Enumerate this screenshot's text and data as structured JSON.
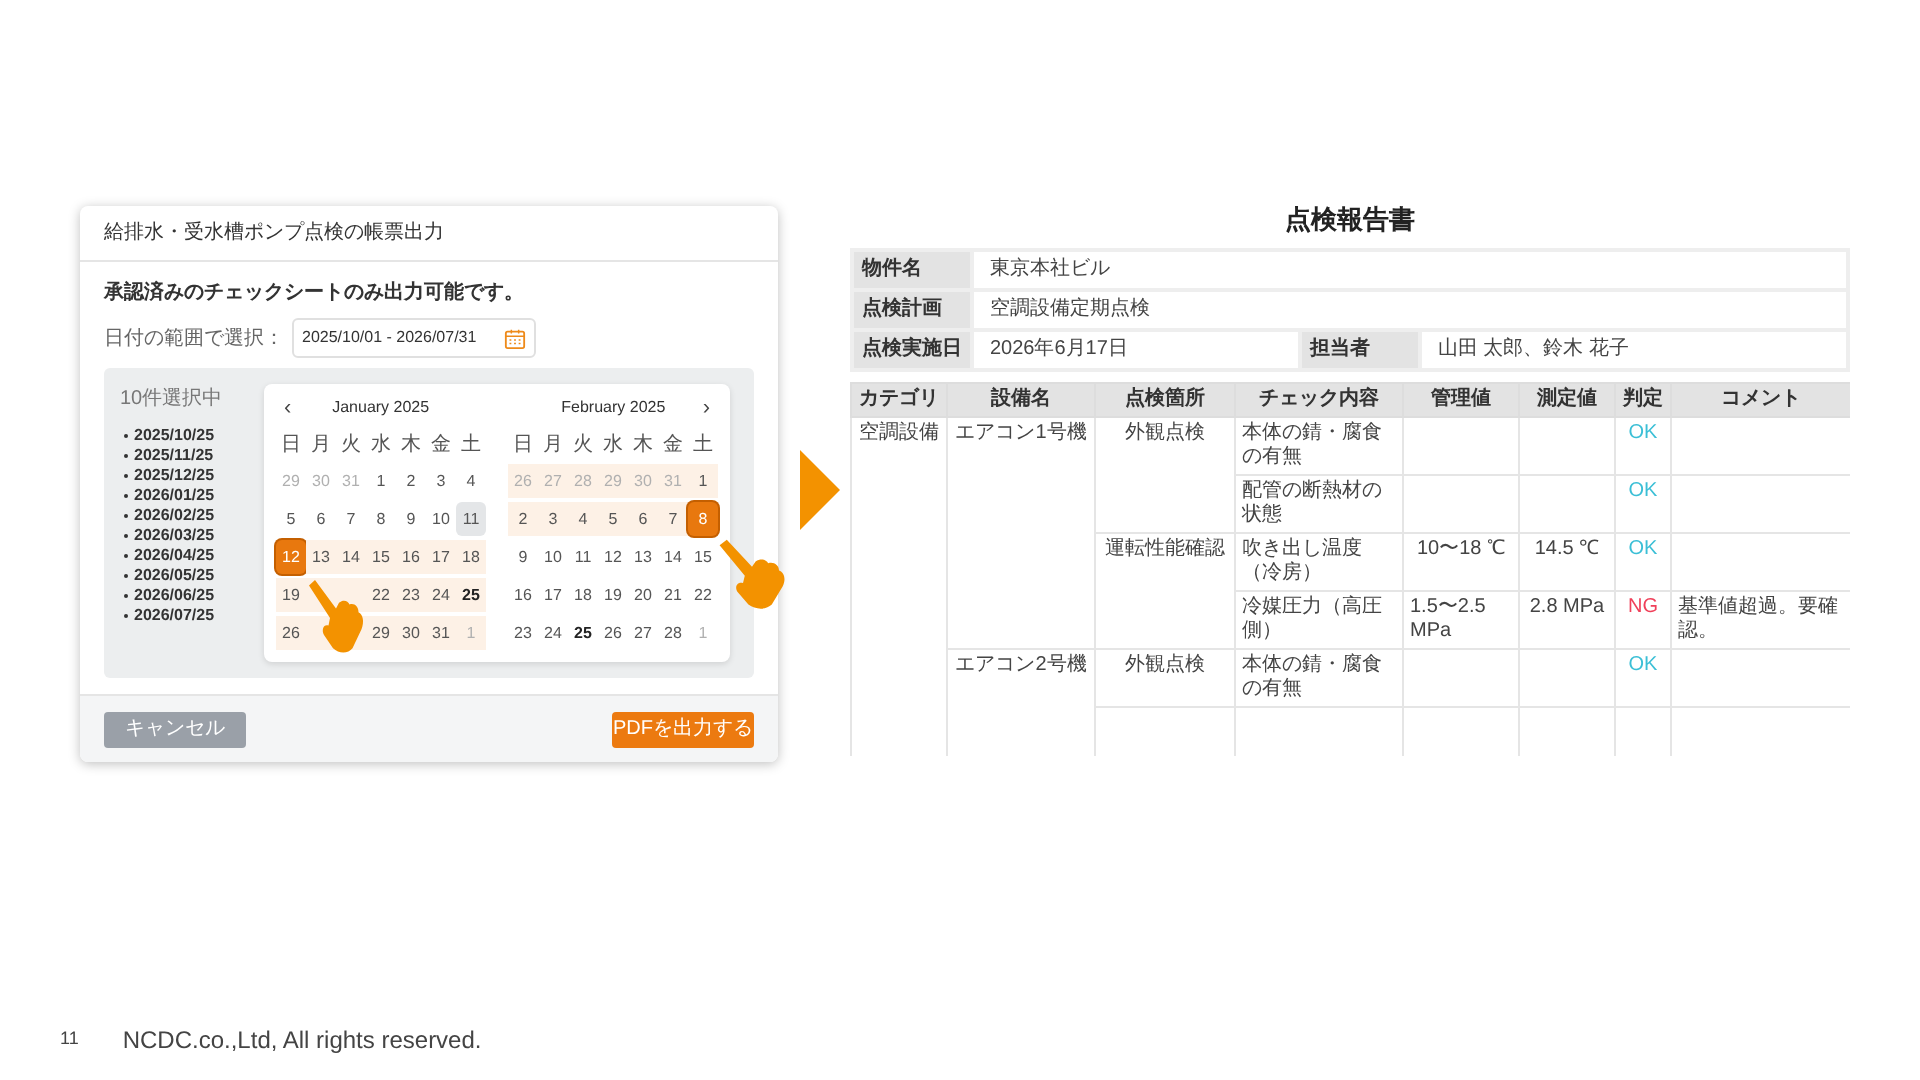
{
  "dialog": {
    "title": "給排水・受水槽ポンプ点検の帳票出力",
    "notice": "承認済みのチェックシートのみ出力可能です。",
    "date_label": "日付の範囲で選択：",
    "date_value": "2025/10/01 - 2026/07/31",
    "selected_count": "10件選択中",
    "selected_dates": [
      "2025/10/25",
      "2025/11/25",
      "2025/12/25",
      "2026/01/25",
      "2026/02/25",
      "2026/03/25",
      "2026/04/25",
      "2026/05/25",
      "2026/06/25",
      "2026/07/25"
    ],
    "prev": "‹",
    "next": "›",
    "months": [
      {
        "title": "January 2025",
        "weekdays": [
          "日",
          "月",
          "火",
          "水",
          "木",
          "金",
          "土"
        ],
        "weeks": [
          [
            {
              "day": "29",
              "kind": "muted"
            },
            {
              "day": "30",
              "kind": "muted"
            },
            {
              "day": "31",
              "kind": "muted"
            },
            {
              "day": "1",
              "kind": "plain"
            },
            {
              "day": "2",
              "kind": "plain"
            },
            {
              "day": "3",
              "kind": "plain"
            },
            {
              "day": "4",
              "kind": "plain"
            }
          ],
          [
            {
              "day": "5",
              "kind": "plain"
            },
            {
              "day": "6",
              "kind": "plain"
            },
            {
              "day": "7",
              "kind": "plain"
            },
            {
              "day": "8",
              "kind": "plain"
            },
            {
              "day": "9",
              "kind": "plain"
            },
            {
              "day": "10",
              "kind": "plain"
            },
            {
              "day": "11",
              "kind": "today"
            }
          ],
          [
            {
              "day": "12",
              "kind": "endpoint"
            },
            {
              "day": "13",
              "kind": "range"
            },
            {
              "day": "14",
              "kind": "range"
            },
            {
              "day": "15",
              "kind": "range"
            },
            {
              "day": "16",
              "kind": "range"
            },
            {
              "day": "17",
              "kind": "range"
            },
            {
              "day": "18",
              "kind": "range"
            }
          ],
          [
            {
              "day": "19",
              "kind": "range"
            },
            {
              "kind": "range"
            },
            {
              "kind": "range"
            },
            {
              "day": "22",
              "kind": "range"
            },
            {
              "day": "23",
              "kind": "range"
            },
            {
              "day": "24",
              "kind": "range"
            },
            {
              "day": "25",
              "kind": "range_bold"
            }
          ],
          [
            {
              "day": "26",
              "kind": "range"
            },
            {
              "kind": "range"
            },
            {
              "kind": "range"
            },
            {
              "day": "29",
              "kind": "range"
            },
            {
              "day": "30",
              "kind": "range"
            },
            {
              "day": "31",
              "kind": "range"
            },
            {
              "day": "1",
              "kind": "range_muted"
            }
          ]
        ]
      },
      {
        "title": "February 2025",
        "weekdays": [
          "日",
          "月",
          "火",
          "水",
          "木",
          "金",
          "土"
        ],
        "weeks": [
          [
            {
              "day": "26",
              "kind": "range_muted"
            },
            {
              "day": "27",
              "kind": "range_muted"
            },
            {
              "day": "28",
              "kind": "range_muted"
            },
            {
              "day": "29",
              "kind": "range_muted"
            },
            {
              "day": "30",
              "kind": "range_muted"
            },
            {
              "day": "31",
              "kind": "range_muted"
            },
            {
              "day": "1",
              "kind": "range"
            }
          ],
          [
            {
              "day": "2",
              "kind": "range"
            },
            {
              "day": "3",
              "kind": "range"
            },
            {
              "day": "4",
              "kind": "range"
            },
            {
              "day": "5",
              "kind": "range"
            },
            {
              "day": "6",
              "kind": "range"
            },
            {
              "day": "7",
              "kind": "range"
            },
            {
              "day": "8",
              "kind": "endpoint"
            }
          ],
          [
            {
              "day": "9",
              "kind": "plain"
            },
            {
              "day": "10",
              "kind": "plain"
            },
            {
              "day": "11",
              "kind": "plain"
            },
            {
              "day": "12",
              "kind": "plain"
            },
            {
              "day": "13",
              "kind": "plain"
            },
            {
              "day": "14",
              "kind": "plain"
            },
            {
              "day": "15",
              "kind": "plain"
            }
          ],
          [
            {
              "day": "16",
              "kind": "plain"
            },
            {
              "day": "17",
              "kind": "plain"
            },
            {
              "day": "18",
              "kind": "plain"
            },
            {
              "day": "19",
              "kind": "plain"
            },
            {
              "day": "20",
              "kind": "plain"
            },
            {
              "day": "21",
              "kind": "plain"
            },
            {
              "day": "22",
              "kind": "plain"
            }
          ],
          [
            {
              "day": "23",
              "kind": "plain"
            },
            {
              "day": "24",
              "kind": "plain"
            },
            {
              "day": "25",
              "kind": "bold"
            },
            {
              "day": "26",
              "kind": "plain"
            },
            {
              "day": "27",
              "kind": "plain"
            },
            {
              "day": "28",
              "kind": "plain"
            },
            {
              "day": "1",
              "kind": "muted"
            }
          ]
        ]
      }
    ],
    "cancel": "キャンセル",
    "submit": "PDFを出力する"
  },
  "report": {
    "title": "点検報告書",
    "info": [
      [
        {
          "label": "物件名",
          "value": "東京本社ビル"
        }
      ],
      [
        {
          "label": "点検計画",
          "value": "空調設備定期点検"
        }
      ],
      [
        {
          "label": "点検実施日",
          "value": "2026年6月17日"
        },
        {
          "label": "担当者",
          "value": "山田 太郎、鈴木 花子"
        }
      ]
    ],
    "columns": [
      "カテゴリ",
      "設備名",
      "点検箇所",
      "チェック内容",
      "管理値",
      "測定値",
      "判定",
      "コメント"
    ],
    "rows": [
      [
        {
          "text": "空調設備",
          "rowspan": 6
        },
        {
          "text": "エアコン1号機",
          "rowspan": 4
        },
        {
          "text": "外観点検",
          "rowspan": 2
        },
        {
          "text": "本体の錆・腐食の有無"
        },
        {
          "text": ""
        },
        {
          "text": ""
        },
        {
          "text": "OK",
          "color": "#3bbfd6"
        },
        {
          "text": ""
        }
      ],
      [
        {
          "text": "配管の断熱材の状態"
        },
        {
          "text": ""
        },
        {
          "text": ""
        },
        {
          "text": "OK",
          "color": "#3bbfd6"
        },
        {
          "text": ""
        }
      ],
      [
        {
          "text": "運転性能確認",
          "rowspan": 2
        },
        {
          "text": "吹き出し温度（冷房）"
        },
        {
          "text": "10〜18 ℃"
        },
        {
          "text": "14.5 ℃"
        },
        {
          "text": "OK",
          "color": "#3bbfd6"
        },
        {
          "text": ""
        }
      ],
      [
        {
          "text": "冷媒圧力（高圧側）"
        },
        {
          "text": "1.5〜2.5 MPa"
        },
        {
          "text": "2.8 MPa"
        },
        {
          "text": "NG",
          "color": "#f0405a"
        },
        {
          "text": "基準値超過。要確認。"
        }
      ],
      [
        {
          "text": "エアコン2号機",
          "rowspan": 2
        },
        {
          "text": "外観点検"
        },
        {
          "text": "本体の錆・腐食の有無"
        },
        {
          "text": ""
        },
        {
          "text": ""
        },
        {
          "text": "OK",
          "color": "#3bbfd6"
        },
        {
          "text": ""
        }
      ],
      [
        {
          "text": ""
        },
        {
          "text": ""
        },
        {
          "text": ""
        },
        {
          "text": ""
        },
        {
          "text": ""
        },
        {
          "text": ""
        }
      ]
    ]
  },
  "footer": {
    "page": "11",
    "copyright": "NCDC.co.,Ltd, All rights reserved."
  }
}
